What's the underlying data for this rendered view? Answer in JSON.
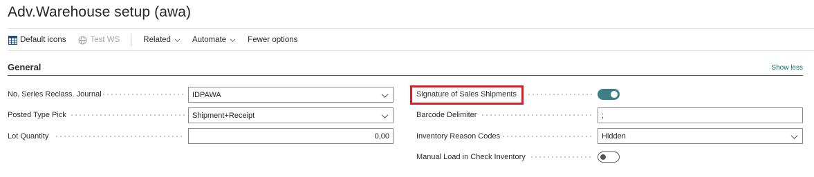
{
  "page": {
    "title": "Adv.Warehouse setup (awa)"
  },
  "actions": {
    "default_icons": {
      "label": "Default icons",
      "icon": "table-grid-icon"
    },
    "test_ws": {
      "label": "Test WS",
      "icon": "globe-icon"
    },
    "related": {
      "label": "Related"
    },
    "automate": {
      "label": "Automate"
    },
    "fewer_options": {
      "label": "Fewer options"
    }
  },
  "section": {
    "title": "General",
    "show_less": "Show less"
  },
  "left_fields": [
    {
      "label": "No. Series Reclass. Journal",
      "value": "IDPAWA",
      "type": "select"
    },
    {
      "label": "Posted Type Pick",
      "value": "Shipment+Receipt",
      "type": "select"
    },
    {
      "label": "Lot Quantity",
      "value": "0,00",
      "type": "number"
    }
  ],
  "right_fields": [
    {
      "label": "Signature of Sales Shipments",
      "type": "toggle",
      "state": "on"
    },
    {
      "label": "Barcode Delimiter",
      "value": ";",
      "type": "text"
    },
    {
      "label": "Inventory Reason Codes",
      "value": "Hidden",
      "type": "select"
    },
    {
      "label": "Manual Load in Check Inventory",
      "type": "toggle",
      "state": "off"
    }
  ],
  "colors": {
    "accent": "#3d7f87",
    "highlight": "#e01c24",
    "link": "#0b6a6a"
  }
}
